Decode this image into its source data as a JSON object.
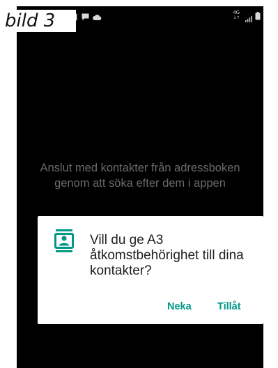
{
  "caption": "bild 3",
  "status_bar": {
    "network_type": "4G",
    "network_sub": "↓↑",
    "icons": [
      "notification-icon",
      "message-icon",
      "cloud-icon",
      "signal-icon",
      "battery-icon"
    ]
  },
  "empty_state": {
    "message": "Anslut med kontakter från adressboken genom att söka efter dem i appen"
  },
  "permission_dialog": {
    "icon": "contacts-icon",
    "message": "Vill du ge A3 åtkomstbehörighet till dina kontakter?",
    "deny_label": "Neka",
    "allow_label": "Tillåt"
  },
  "colors": {
    "background": "#000000",
    "dialog_bg": "#ffffff",
    "accent": "#009688",
    "muted_text": "#6a6a6a"
  }
}
